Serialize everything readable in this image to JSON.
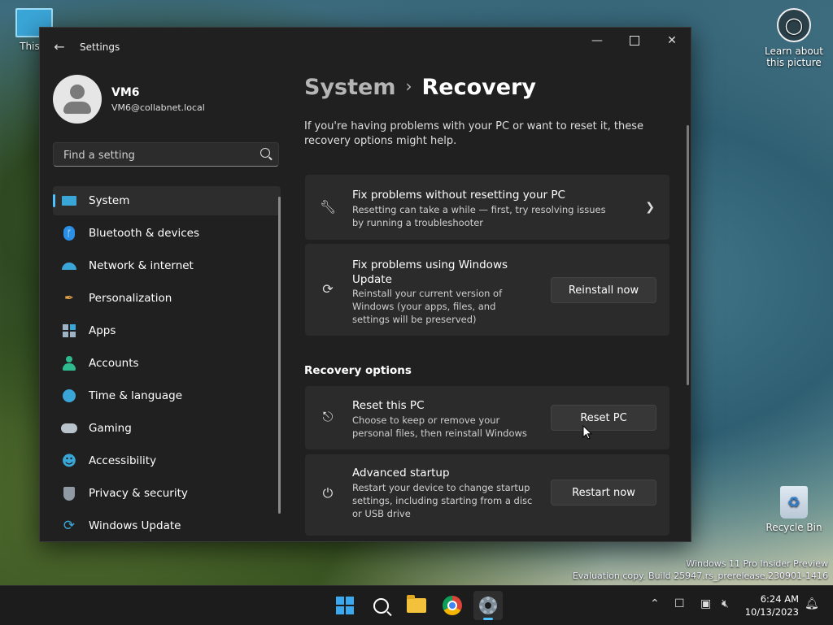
{
  "desktop": {
    "this_pc_label": "This P",
    "learn_label": "Learn about this picture",
    "recycle_label": "Recycle Bin",
    "watermark_line1": "Windows 11 Pro Insider Preview",
    "watermark_line2": "Evaluation copy. Build 25947.rs_prerelease.230901-1416"
  },
  "window": {
    "app_title": "Settings"
  },
  "profile": {
    "name": "VM6",
    "email": "VM6@collabnet.local"
  },
  "search": {
    "placeholder": "Find a setting"
  },
  "nav": {
    "items": [
      {
        "label": "System",
        "icon": "monitor-icon",
        "selected": true
      },
      {
        "label": "Bluetooth & devices",
        "icon": "bluetooth-icon"
      },
      {
        "label": "Network & internet",
        "icon": "wifi-icon"
      },
      {
        "label": "Personalization",
        "icon": "brush-icon"
      },
      {
        "label": "Apps",
        "icon": "apps-icon"
      },
      {
        "label": "Accounts",
        "icon": "person-icon"
      },
      {
        "label": "Time & language",
        "icon": "globe-clock-icon"
      },
      {
        "label": "Gaming",
        "icon": "gamepad-icon"
      },
      {
        "label": "Accessibility",
        "icon": "accessibility-icon"
      },
      {
        "label": "Privacy & security",
        "icon": "shield-icon"
      },
      {
        "label": "Windows Update",
        "icon": "update-icon"
      }
    ]
  },
  "breadcrumb": {
    "parent": "System",
    "current": "Recovery"
  },
  "intro": "If you're having problems with your PC or want to reset it, these recovery options might help.",
  "cards": {
    "fix_no_reset": {
      "title": "Fix problems without resetting your PC",
      "desc": "Resetting can take a while — first, try resolving issues by running a troubleshooter"
    },
    "fix_update": {
      "title": "Fix problems using Windows Update",
      "desc": "Reinstall your current version of Windows (your apps, files, and settings will be preserved)",
      "button": "Reinstall now"
    },
    "reset": {
      "title": "Reset this PC",
      "desc": "Choose to keep or remove your personal files, then reinstall Windows",
      "button": "Reset PC"
    },
    "advanced": {
      "title": "Advanced startup",
      "desc": "Restart your device to change startup settings, including starting from a disc or USB drive",
      "button": "Restart now"
    }
  },
  "section_recovery_options": "Recovery options",
  "taskbar": {
    "time": "6:24 AM",
    "date": "10/13/2023"
  },
  "colors": {
    "accent": "#4cc2ff",
    "window_bg": "#202020",
    "card_bg": "#2b2b2b"
  }
}
